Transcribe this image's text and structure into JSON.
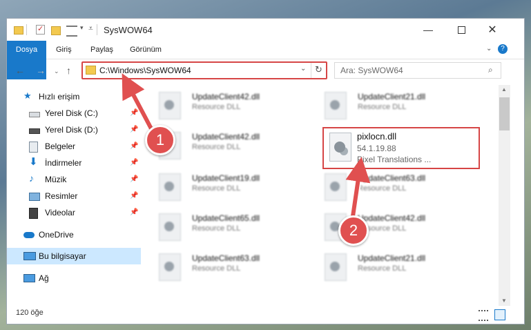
{
  "window": {
    "title": "SysWOW64"
  },
  "ribbon": {
    "tabs": [
      "Dosya",
      "Giriş",
      "Paylaş",
      "Görünüm"
    ]
  },
  "address": {
    "path": "C:\\Windows\\SysWOW64"
  },
  "search": {
    "placeholder": "Ara: SysWOW64"
  },
  "sidebar": {
    "quick_access": "Hızlı erişim",
    "items": [
      {
        "label": "Yerel Disk (C:)",
        "icon": "drive-icon",
        "pinned": true
      },
      {
        "label": "Yerel Disk (D:)",
        "icon": "drive-icon",
        "pinned": true
      },
      {
        "label": "Belgeler",
        "icon": "documents-icon",
        "pinned": true
      },
      {
        "label": "İndirmeler",
        "icon": "downloads-icon",
        "pinned": true
      },
      {
        "label": "Müzik",
        "icon": "music-icon",
        "pinned": true
      },
      {
        "label": "Resimler",
        "icon": "pictures-icon",
        "pinned": true
      },
      {
        "label": "Videolar",
        "icon": "videos-icon",
        "pinned": true
      }
    ],
    "onedrive": "OneDrive",
    "this_pc": "Bu bilgisayar",
    "network": "Ağ"
  },
  "files": [
    {
      "name": "UpdateClient42.dll",
      "type": "Resource DLL"
    },
    {
      "name": "UpdateClient21.dll",
      "type": "Resource DLL"
    },
    {
      "name": "UpdateClient42.dll",
      "type": "Resource DLL"
    },
    {
      "name": "UpdateClient19.dll",
      "type": "Resource DLL"
    },
    {
      "name": "UpdateClient63.dll",
      "type": "Resource DLL"
    },
    {
      "name": "UpdateClient65.dll",
      "type": "Resource DLL"
    },
    {
      "name": "UpdateClient42.dll",
      "type": "Resource DLL"
    },
    {
      "name": "UpdateClient63.dll",
      "type": "Resource DLL"
    },
    {
      "name": "UpdateClient21.dll",
      "type": "Resource DLL"
    }
  ],
  "highlighted_file": {
    "name": "pixlocn.dll",
    "version": "54.1.19.88",
    "description": "Pixel Translations ..."
  },
  "status": {
    "item_count": "120 öğe"
  },
  "badges": {
    "one": "1",
    "two": "2"
  },
  "colors": {
    "accent": "#1979ca",
    "highlight": "#d64545",
    "selected": "#cce8ff"
  }
}
